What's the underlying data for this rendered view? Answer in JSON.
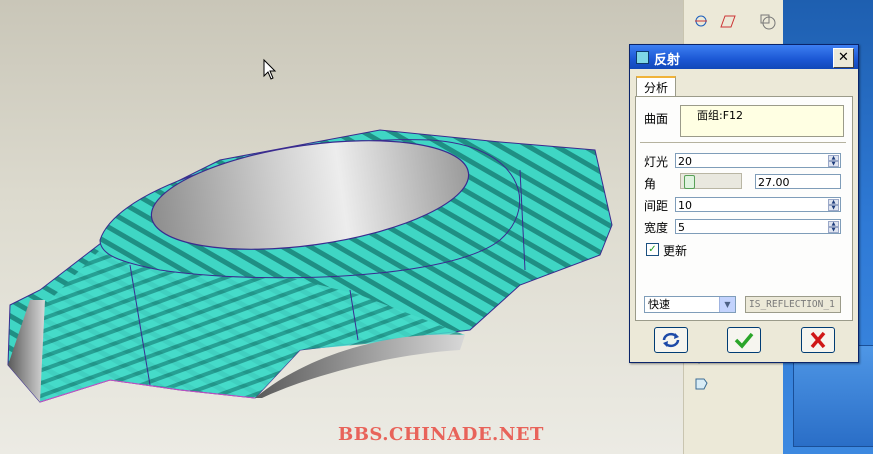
{
  "dialog": {
    "title": "反射",
    "close_glyph": "✕",
    "tab_label": "分析",
    "surface_label": "曲面",
    "surface_value": "面组:F12",
    "light_label": "灯光",
    "light_value": "20",
    "angle_label": "角",
    "angle_value": "27.00",
    "spacing_label": "间距",
    "spacing_value": "10",
    "width_label": "宽度",
    "width_value": "5",
    "update_label": "更新",
    "update_checked": true,
    "speed_value": "快速",
    "reflection_name": "IS_REFLECTION_1",
    "buttons": {
      "repaint_icon": "refresh-icon",
      "ok_icon": "checkmark-icon",
      "cancel_icon": "red-x-icon"
    }
  },
  "watermark": "BBS.CHINADE.NET",
  "colors": {
    "surface_teal": "#3fd6c4",
    "stripe_dark": "#1f8f84",
    "title_blue": "#1b57d4",
    "ok_green": "#2aa52a",
    "cancel_red": "#d01818"
  }
}
